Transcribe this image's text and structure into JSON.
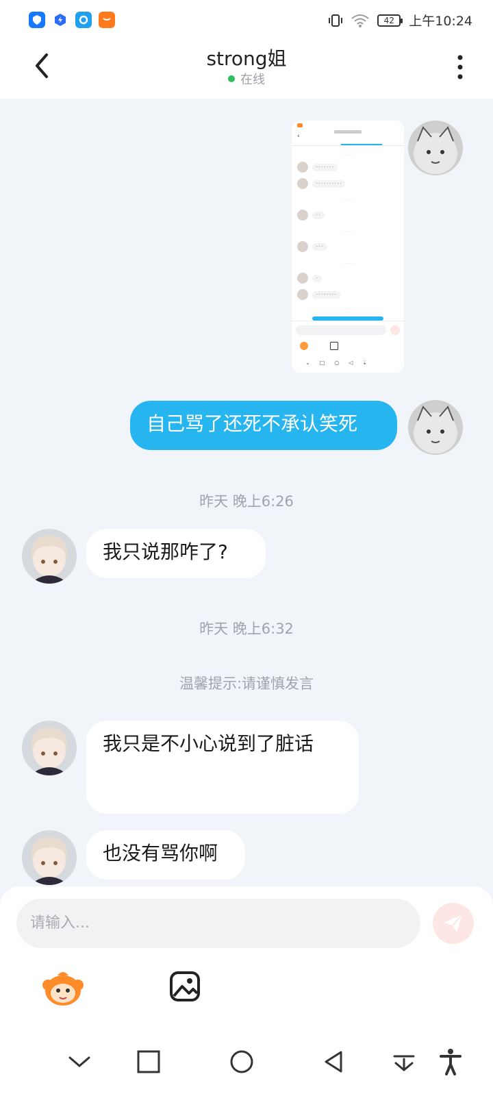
{
  "status_bar": {
    "battery": "42",
    "time": "上午10:24"
  },
  "header": {
    "title": "strong姐",
    "status": "在线"
  },
  "chat": {
    "my_message_1": "自己骂了还死不承认笑死",
    "time_1": "昨天 晚上6:26",
    "their_message_1": "我只说那咋了?",
    "time_2": "昨天 晚上6:32",
    "tip": "温馨提示:请谨慎发言",
    "their_message_2": "我只是不小心说到了脏话",
    "their_message_3": "也没有骂你啊"
  },
  "input": {
    "placeholder": "请输入..."
  },
  "colors": {
    "my_bubble": "#27b5f0",
    "online_dot": "#29c05a",
    "send_bg": "#fde6e3"
  }
}
